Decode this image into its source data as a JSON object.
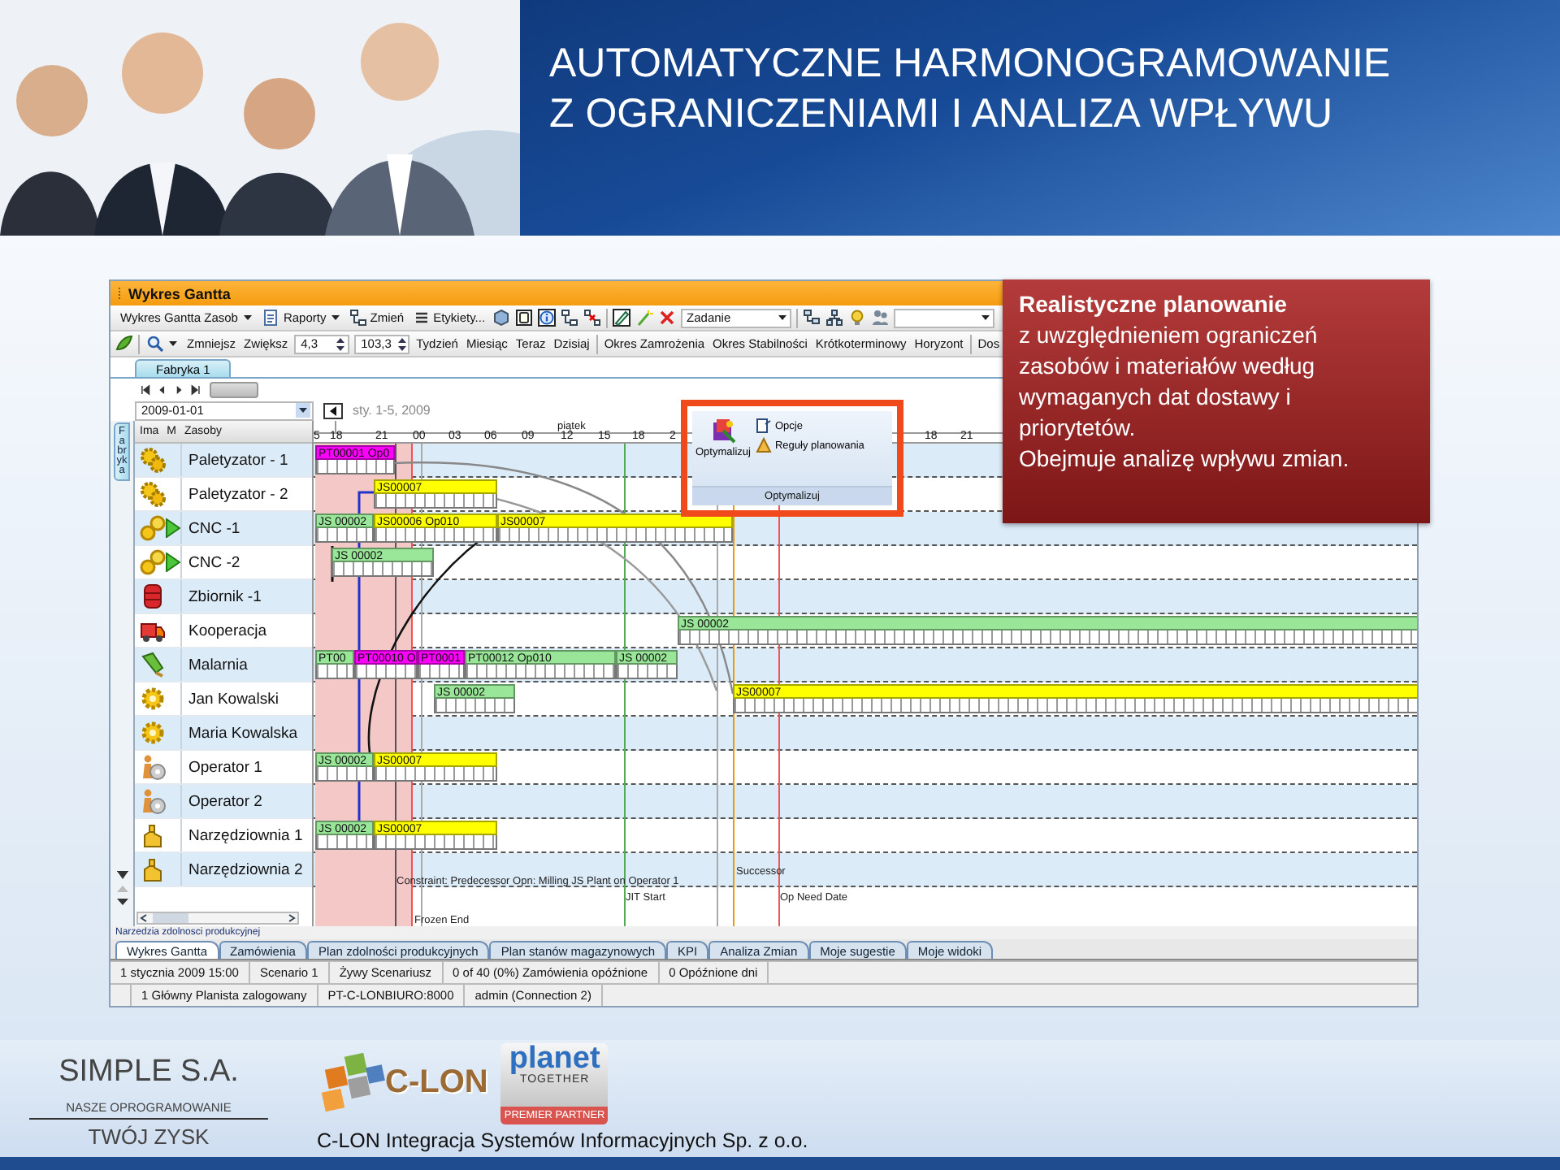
{
  "header": {
    "title_lines": [
      "AUTOMATYCZNE HARMONOGRAMOWANIE",
      "Z OGRANICZENIAMI I ANALIZA WPŁYWU"
    ]
  },
  "app": {
    "title": "Wykres Gantta",
    "toolbar_1": [
      {
        "kind": "dropdown",
        "label": "Wykres Gantta Zasob"
      },
      {
        "kind": "menu",
        "label": "Raporty"
      },
      {
        "kind": "button",
        "label": "Zmień"
      },
      {
        "kind": "button",
        "label": "Etykiety..."
      },
      {
        "kind": "dropdown",
        "label": "Zadanie"
      }
    ],
    "toolbar_2": [
      {
        "kind": "button",
        "label": "Zmniejsz"
      },
      {
        "kind": "button",
        "label": "Zwiększ"
      },
      {
        "kind": "spin",
        "value": "4,3"
      },
      {
        "kind": "spin",
        "value": "103,3"
      },
      {
        "kind": "button",
        "label": "Tydzień"
      },
      {
        "kind": "button",
        "label": "Miesiąc"
      },
      {
        "kind": "button",
        "label": "Teraz"
      },
      {
        "kind": "button",
        "label": "Dzisiaj"
      },
      {
        "kind": "button",
        "label": "Okres Zamrożenia"
      },
      {
        "kind": "button",
        "label": "Okres Stabilności"
      },
      {
        "kind": "button",
        "label": "Krótkoterminowy"
      },
      {
        "kind": "button",
        "label": "Horyzont"
      },
      {
        "kind": "button",
        "label": "Dos"
      }
    ],
    "sheet_tabs": [
      {
        "label": "Fabryka 1",
        "selected": true
      }
    ],
    "date": "2009-01-01",
    "range": "sty. 1-5, 2009",
    "side_tab": "Fabryka",
    "columns": [
      "Ima",
      "M",
      "Zasoby"
    ],
    "day": "piątek",
    "ticks": [
      "5",
      "18",
      "21",
      "00",
      "03",
      "06",
      "09",
      "12",
      "15",
      "18",
      "2",
      "18",
      "21"
    ],
    "resources": [
      {
        "name": "Paletyzator - 1",
        "kind": "gears",
        "flag": false,
        "bars": [
          {
            "label": "PT00001 Op0",
            "color": "#ff00ff"
          }
        ]
      },
      {
        "name": "Paletyzator - 2",
        "kind": "gears",
        "flag": false,
        "bars": [
          {
            "label": "JS00007",
            "color": "#ffff00"
          }
        ]
      },
      {
        "name": "CNC -1",
        "kind": "cogs",
        "flag": true,
        "bars": [
          {
            "label": "JS 00002",
            "color": "#99e699"
          },
          {
            "label": "JS00006 Op010",
            "color": "#ffff00"
          },
          {
            "label": "JS00007",
            "color": "#ffff00"
          }
        ]
      },
      {
        "name": "CNC -2",
        "kind": "cogs",
        "flag": true,
        "bars": [
          {
            "label": "JS 00002",
            "color": "#99e699"
          }
        ]
      },
      {
        "name": "Zbiornik -1",
        "kind": "tank",
        "flag": false
      },
      {
        "name": "Kooperacja",
        "kind": "truck",
        "flag": false,
        "bars": [
          {
            "label": "JS 00002",
            "color": "#99e699"
          }
        ]
      },
      {
        "name": "Malarnia",
        "kind": "brush",
        "flag": false,
        "bars": [
          {
            "label": "PT00",
            "color": "#99e699"
          },
          {
            "label": "PT00010 O",
            "color": "#ff00ff"
          },
          {
            "label": "PT0001",
            "color": "#ff00ff"
          },
          {
            "label": "PT00012 Op010",
            "color": "#99e699"
          },
          {
            "label": "JS 00002",
            "color": "#99e699"
          }
        ]
      },
      {
        "name": "Jan Kowalski",
        "kind": "gear",
        "flag": false,
        "bars": [
          {
            "label": "JS 00002",
            "color": "#99e699"
          },
          {
            "label": "JS00007",
            "color": "#ffff00"
          }
        ]
      },
      {
        "name": "Maria Kowalska",
        "kind": "gear",
        "flag": false
      },
      {
        "name": "Operator 1",
        "kind": "operator",
        "flag": false,
        "bars": [
          {
            "label": "JS 00002",
            "color": "#99e699"
          },
          {
            "label": "JS00007",
            "color": "#ffff00"
          }
        ]
      },
      {
        "name": "Operator 2",
        "kind": "operator",
        "flag": false
      },
      {
        "name": "Narzędziownia 1",
        "kind": "tool",
        "flag": false,
        "bars": [
          {
            "label": "JS 00002",
            "color": "#99e699"
          },
          {
            "label": "JS00007",
            "color": "#ffff00"
          }
        ]
      },
      {
        "name": "Narzędziownia 2",
        "kind": "tool",
        "flag": false
      }
    ],
    "annotations": [
      {
        "kind": "constraint",
        "text": "Constraint: Predecessor Opn: Milling JS Plant on Operator 1"
      },
      {
        "kind": "jit",
        "text": "JIT Start"
      },
      {
        "kind": "successor",
        "text": "Successor"
      },
      {
        "kind": "need",
        "text": "Op Need Date"
      },
      {
        "kind": "frozen",
        "text": "Frozen End"
      }
    ],
    "popup": {
      "button": "Optymalizuj",
      "options": [
        "Opcje",
        "Reguły planowania"
      ],
      "group": "Optymalizuj"
    },
    "tools_label": "Narzedzia zdolnosci produkcyjnej",
    "bottom_tabs": [
      {
        "label": "Wykres Gantta",
        "selected": true
      },
      {
        "label": "Zamówienia",
        "selected": false
      },
      {
        "label": "Plan zdolności produkcyjnych",
        "selected": false
      },
      {
        "label": "Plan stanów magazynowych",
        "selected": false
      },
      {
        "label": "KPI",
        "selected": false
      },
      {
        "label": "Analiza Zmian",
        "selected": false
      },
      {
        "label": "Moje sugestie",
        "selected": false
      },
      {
        "label": "Moje widoki",
        "selected": false
      }
    ],
    "status_1": [
      "1 stycznia 2009 15:00",
      "Scenario 1",
      "Żywy Scenariusz",
      "0 of 40 (0%) Zamówienia opóźnione",
      "0 Opóźnione dni"
    ],
    "status_2": [
      "1 Główny Planista zalogowany",
      "PT-C-LONBIURO:8000",
      "admin (Connection 2)"
    ]
  },
  "callout": {
    "heading": "Realistyczne planowanie",
    "text": "z uwzględnieniem ograniczeń zasobów i materiałów według wymaganych dat dostawy i priorytetów.",
    "note": "Obejmuje analizę wpływu zmian."
  },
  "footer": {
    "company": "SIMPLE S.A.",
    "tagline_top": "NASZE OPROGRAMOWANIE",
    "tagline_bottom": "TWÓJ ZYSK",
    "logo_text": "C-LON",
    "badge_top": "planet",
    "badge_middle": "TOGETHER",
    "badge_bottom": "PREMIER PARTNER",
    "caption": "C-LON Integracja Systemów Informacyjnych Sp. z o.o."
  }
}
